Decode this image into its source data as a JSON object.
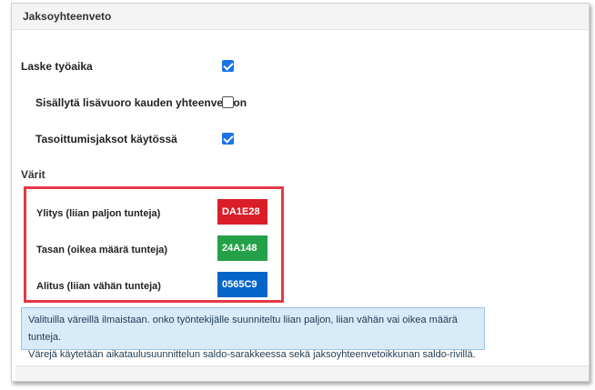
{
  "panel": {
    "title": "Jaksoyhteenveto"
  },
  "settings": [
    {
      "label": "Laske työaika",
      "checked": true
    },
    {
      "label": "Sisällytä lisävuoro kauden yhteenvetoon",
      "checked": false
    },
    {
      "label": "Tasoittumisjaksot käytössä",
      "checked": true
    }
  ],
  "colors": {
    "heading": "Värit",
    "items": [
      {
        "label": "Ylitys (liian paljon tunteja)",
        "value": "DA1E28",
        "hex": "#DA1E28"
      },
      {
        "label": "Tasan (oikea määrä tunteja)",
        "value": "24A148",
        "hex": "#24A148"
      },
      {
        "label": "Alitus (liian vähän tunteja)",
        "value": "0565C9",
        "hex": "#0565C9"
      }
    ]
  },
  "info": {
    "line1": "Valituilla väreillä ilmaistaan. onko työntekijälle suunniteltu liian paljon, liian vähän vai oikea määrä tunteja.",
    "line2": "Värejä käytetään aikataulusuunnittelun saldo-sarakkeessa sekä jaksoyhteenvetoikkunan saldo-rivillä."
  },
  "theme": {
    "accent": "#1a73e8",
    "highlight_border": "#e53945",
    "info_bg": "#d8ebf8"
  }
}
